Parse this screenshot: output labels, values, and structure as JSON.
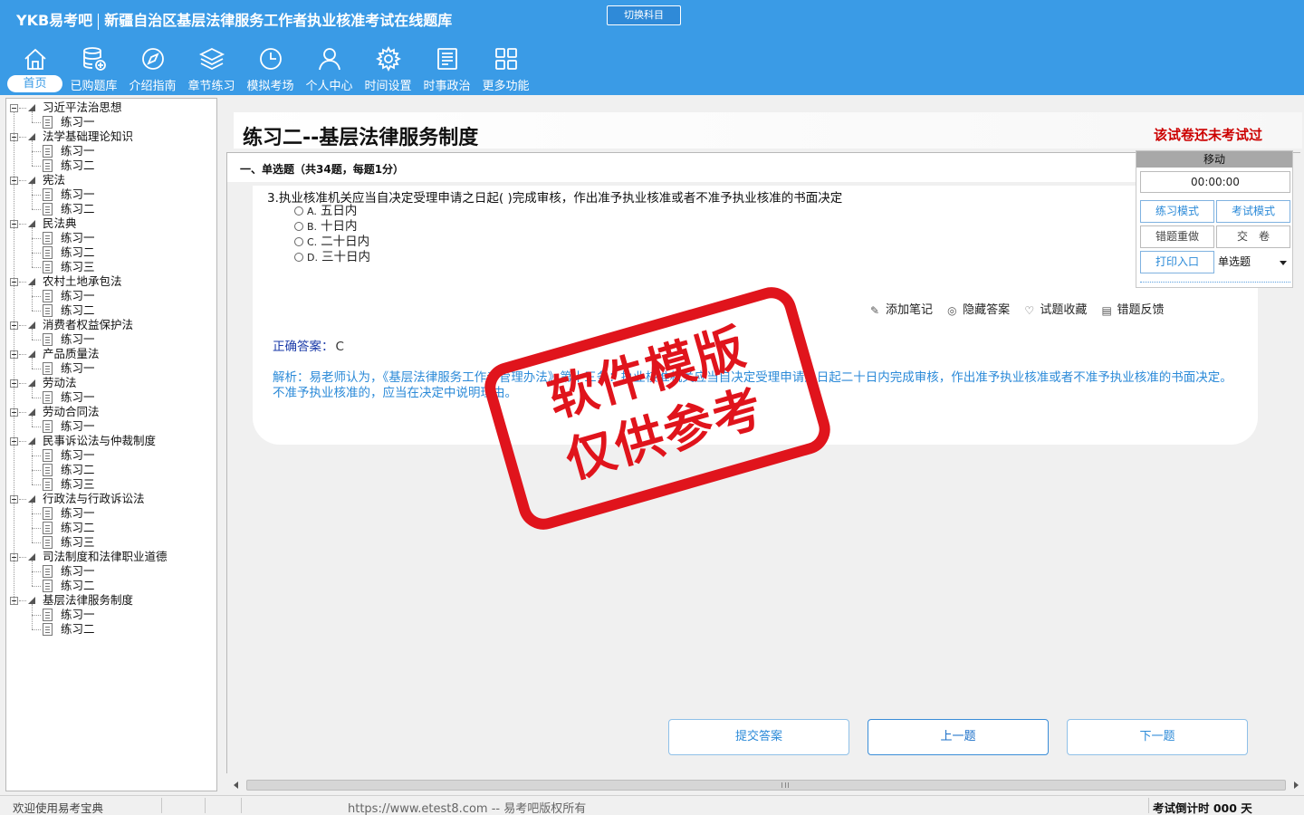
{
  "header": {
    "brand": "YKB易考吧",
    "title": "新疆自治区基层法律服务工作者执业核准考试在线题库",
    "switch_subject": "切换科目",
    "nav": [
      {
        "label": "首页",
        "icon": "home-icon",
        "active": true
      },
      {
        "label": "已购题库",
        "icon": "database-icon"
      },
      {
        "label": "介绍指南",
        "icon": "compass-icon"
      },
      {
        "label": "章节练习",
        "icon": "layers-icon"
      },
      {
        "label": "模拟考场",
        "icon": "clock-icon"
      },
      {
        "label": "个人中心",
        "icon": "user-icon"
      },
      {
        "label": "时间设置",
        "icon": "gear-icon"
      },
      {
        "label": "时事政治",
        "icon": "news-icon"
      },
      {
        "label": "更多功能",
        "icon": "grid-icon"
      }
    ]
  },
  "tree": [
    {
      "label": "习近平法治思想",
      "children": [
        "练习一"
      ]
    },
    {
      "label": "法学基础理论知识",
      "children": [
        "练习一",
        "练习二"
      ]
    },
    {
      "label": "宪法",
      "children": [
        "练习一",
        "练习二"
      ]
    },
    {
      "label": "民法典",
      "children": [
        "练习一",
        "练习二",
        "练习三"
      ]
    },
    {
      "label": "农村土地承包法",
      "children": [
        "练习一",
        "练习二"
      ]
    },
    {
      "label": "消费者权益保护法",
      "children": [
        "练习一"
      ]
    },
    {
      "label": "产品质量法",
      "children": [
        "练习一"
      ]
    },
    {
      "label": "劳动法",
      "children": [
        "练习一"
      ]
    },
    {
      "label": "劳动合同法",
      "children": [
        "练习一"
      ]
    },
    {
      "label": "民事诉讼法与仲裁制度",
      "children": [
        "练习一",
        "练习二",
        "练习三"
      ]
    },
    {
      "label": "行政法与行政诉讼法",
      "children": [
        "练习一",
        "练习二",
        "练习三"
      ]
    },
    {
      "label": "司法制度和法律职业道德",
      "children": [
        "练习一",
        "练习二"
      ]
    },
    {
      "label": "基层法律服务制度",
      "children": [
        "练习一",
        "练习二"
      ]
    }
  ],
  "paper": {
    "title": "练习二--基层法律服务制度",
    "status": "该试卷还未考试过",
    "section": "一、单选题（共34题，每题1分）"
  },
  "question": {
    "text": "3.执业核准机关应当自决定受理申请之日起( )完成审核，作出准予执业核准或者不准予执业核准的书面决定",
    "options": [
      {
        "key": "A.",
        "text": "五日内"
      },
      {
        "key": "B.",
        "text": "十日内"
      },
      {
        "key": "C.",
        "text": "二十日内"
      },
      {
        "key": "D.",
        "text": "三十日内"
      }
    ],
    "tools": [
      {
        "label": "添加笔记",
        "icon": "pencil-icon"
      },
      {
        "label": "隐藏答案",
        "icon": "eye-hide-icon"
      },
      {
        "label": "试题收藏",
        "icon": "heart-icon"
      },
      {
        "label": "错题反馈",
        "icon": "feedback-icon"
      }
    ],
    "answer_label": "正确答案：",
    "answer_value": "C",
    "analysis": "解析：易老师认为，《基层法律服务工作者管理办法》第十三条：执业核准机关应当自决定受理申请之日起二十日内完成审核，作出准予执业核准或者不准予执业核准的书面决定。不准予执业核准的，应当在决定中说明理由。"
  },
  "panel": {
    "move": "移动",
    "timer": "00:00:00",
    "practice_mode": "练习模式",
    "exam_mode": "考试模式",
    "redo_wrong": "错题重做",
    "submit_paper": "交　卷",
    "print": "打印入口",
    "qtype": "单选题"
  },
  "buttons": {
    "submit": "提交答案",
    "prev": "上一题",
    "next": "下一题"
  },
  "watermark": {
    "line1": "软件模版",
    "line2": "仅供参考"
  },
  "status": {
    "welcome": "欢迎使用易考宝典",
    "copyright": "https://www.etest8.com -- 易考吧版权所有",
    "countdown": "考试倒计时 000 天"
  },
  "colors": {
    "header_bg": "#3a9be6",
    "accent": "#2b8ad8",
    "status_red": "#cc0000",
    "stamp_red": "#e0141c"
  }
}
